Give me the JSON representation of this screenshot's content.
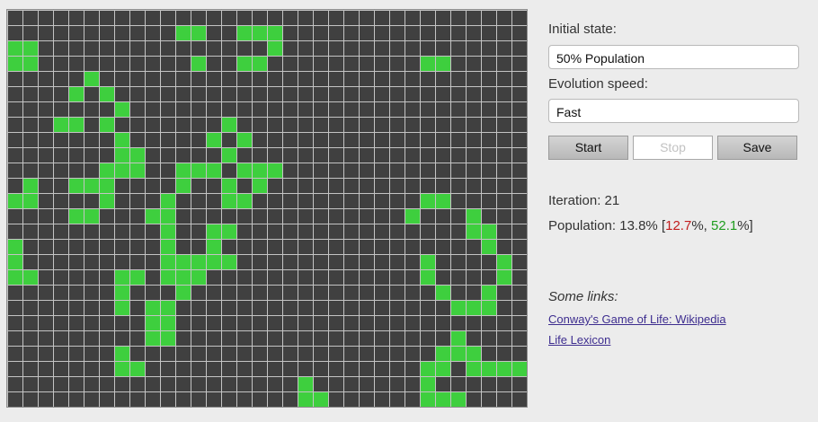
{
  "board": {
    "cols": 34,
    "rows": 26,
    "colors": {
      "alive": "#3ecf3e",
      "dead": "#404040",
      "grid": "#c4c4c4"
    },
    "alive_cells": [
      [
        11,
        1
      ],
      [
        12,
        1
      ],
      [
        15,
        1
      ],
      [
        16,
        1
      ],
      [
        17,
        1
      ],
      [
        0,
        2
      ],
      [
        1,
        2
      ],
      [
        17,
        2
      ],
      [
        0,
        3
      ],
      [
        1,
        3
      ],
      [
        12,
        3
      ],
      [
        16,
        3
      ],
      [
        12,
        4
      ],
      [
        15,
        4
      ],
      [
        16,
        4
      ],
      [
        27,
        4
      ],
      [
        28,
        4
      ],
      [
        5,
        5
      ],
      [
        4,
        6
      ],
      [
        6,
        6
      ],
      [
        7,
        7
      ],
      [
        3,
        8
      ],
      [
        4,
        8
      ],
      [
        6,
        8
      ],
      [
        14,
        8
      ],
      [
        7,
        9
      ],
      [
        13,
        9
      ],
      [
        15,
        9
      ],
      [
        7,
        10
      ],
      [
        8,
        10
      ],
      [
        14,
        10
      ],
      [
        8,
        11
      ],
      [
        12,
        11
      ],
      [
        16,
        11
      ],
      [
        6,
        12
      ],
      [
        7,
        12
      ],
      [
        8,
        12
      ],
      [
        11,
        12
      ],
      [
        12,
        12
      ],
      [
        13,
        12
      ],
      [
        15,
        12
      ],
      [
        16,
        12
      ],
      [
        17,
        12
      ],
      [
        1,
        13
      ],
      [
        4,
        13
      ],
      [
        5,
        13
      ],
      [
        6,
        13
      ],
      [
        11,
        13
      ],
      [
        14,
        13
      ],
      [
        16,
        13
      ],
      [
        0,
        14
      ],
      [
        1,
        14
      ],
      [
        6,
        14
      ],
      [
        10,
        14
      ],
      [
        14,
        14
      ],
      [
        15,
        14
      ],
      [
        27,
        14
      ],
      [
        28,
        14
      ],
      [
        4,
        15
      ],
      [
        5,
        15
      ],
      [
        9,
        15
      ],
      [
        10,
        15
      ],
      [
        26,
        15
      ],
      [
        30,
        15
      ],
      [
        10,
        16
      ],
      [
        13,
        16
      ],
      [
        14,
        16
      ],
      [
        30,
        16
      ],
      [
        31,
        16
      ],
      [
        0,
        17
      ],
      [
        10,
        17
      ],
      [
        13,
        17
      ],
      [
        31,
        17
      ],
      [
        0,
        18
      ],
      [
        10,
        18
      ],
      [
        11,
        18
      ],
      [
        12,
        18
      ],
      [
        13,
        18
      ],
      [
        14,
        18
      ],
      [
        32,
        18
      ],
      [
        0,
        19
      ],
      [
        13,
        19
      ],
      [
        27,
        19
      ],
      [
        32,
        19
      ],
      [
        0,
        20
      ],
      [
        1,
        20
      ],
      [
        7,
        20
      ],
      [
        8,
        20
      ],
      [
        10,
        20
      ],
      [
        11,
        20
      ],
      [
        12,
        20
      ],
      [
        27,
        20
      ],
      [
        32,
        20
      ],
      [
        7,
        21
      ],
      [
        11,
        21
      ],
      [
        28,
        21
      ],
      [
        31,
        21
      ],
      [
        7,
        22
      ],
      [
        9,
        22
      ],
      [
        10,
        22
      ],
      [
        29,
        22
      ],
      [
        30,
        22
      ],
      [
        31,
        22
      ],
      [
        9,
        23
      ],
      [
        10,
        23
      ],
      [
        9,
        24
      ],
      [
        10,
        24
      ],
      [
        29,
        24
      ],
      [
        7,
        25
      ],
      [
        28,
        25
      ],
      [
        29,
        25
      ],
      [
        30,
        25
      ],
      [
        7,
        26
      ],
      [
        8,
        26
      ],
      [
        27,
        26
      ],
      [
        30,
        26
      ],
      [
        31,
        26
      ],
      [
        32,
        26
      ],
      [
        33,
        26
      ],
      [
        28,
        27
      ],
      [
        30,
        27
      ],
      [
        19,
        28
      ],
      [
        27,
        28
      ],
      [
        19,
        29
      ],
      [
        20,
        29
      ],
      [
        27,
        29
      ],
      [
        28,
        29
      ],
      [
        29,
        29
      ]
    ]
  },
  "controls": {
    "initial_state_label": "Initial state:",
    "initial_state_value": "50% Population",
    "speed_label": "Evolution speed:",
    "speed_value": "Fast",
    "start_label": "Start",
    "stop_label": "Stop",
    "save_label": "Save"
  },
  "stats": {
    "iteration_label": "Iteration:",
    "iteration": "21",
    "population_label": "Population:",
    "population": "13.8%",
    "open_bracket": "[",
    "min": "12.7",
    "pct_sep": "%, ",
    "max": "52.1",
    "close_bracket": "%]"
  },
  "links": {
    "title": "Some links:",
    "items": [
      "Conway's Game of Life: Wikipedia",
      "Life Lexicon"
    ]
  }
}
